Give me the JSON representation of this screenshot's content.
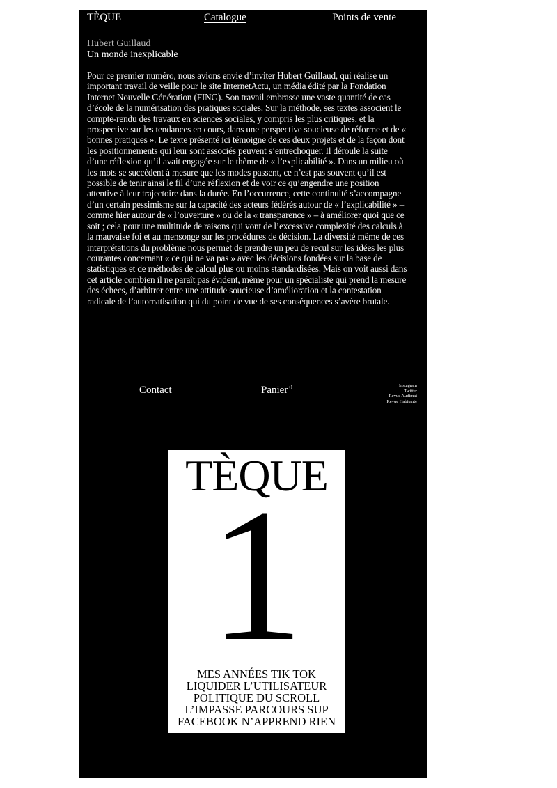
{
  "nav": {
    "brand": "TÈQUE",
    "catalogue": "Catalogue",
    "stores": "Points de vente"
  },
  "article": {
    "author": "Hubert Guillaud",
    "title": "Un monde inexplicable",
    "body": "Pour ce premier numéro, nous avions envie d’inviter Hubert Guillaud, qui réalise un important travail de veille pour le site InternetActu, un média édité par la Fondation Internet Nouvelle Génération (FING). Son travail embrasse une vaste quantité de cas d’école de la numérisation des pratiques sociales. Sur la méthode, ses textes associent le compte-rendu des travaux en sciences sociales, y compris les plus critiques, et la prospective sur les tendances en cours, dans une perspective soucieuse de réforme et de « bonnes pratiques ». Le texte présenté ici témoigne de ces deux projets et de la façon dont les positionnements qui leur sont associés peuvent s’entrechoquer. Il déroule la suite d’une réflexion qu’il avait engagée sur le thème de « l’explicabilité ». Dans un milieu où les mots se succèdent à mesure que les modes passent, ce n’est pas souvent qu’il est possible de tenir ainsi le fil d’une réflexion et de voir ce qu’engendre une position attentive à leur trajectoire dans la durée. En l’occurrence, cette continuité s’accompagne d’un certain pessimisme sur la capacité des acteurs fédérés autour de « l’explicabilité » – comme hier autour de « l’ouverture » ou de la « transparence » – à améliorer quoi que ce soit ; cela pour une multitude de raisons qui vont de l’excessive complexité des calculs à la mauvaise foi et au mensonge sur les procédures de décision. La diversité même de ces interprétations du problème nous permet de prendre un peu de recul sur les idées les plus courantes concernant « ce qui ne va pas » avec les décisions fondées sur la base de statistiques et de méthodes de calcul plus ou moins standardisées. Mais on voit aussi dans cet article combien il ne paraît pas évident, même pour un spécialiste qui prend la mesure des échecs, d’arbitrer entre une attitude soucieuse d’amélioration et la contestation radicale de l’automatisation qui du point de vue de ses conséquences s’avère brutale."
  },
  "footer": {
    "contact": "Contact",
    "cart": "Panier",
    "cart_count": "0",
    "social": [
      "Instagram",
      "Twitter",
      "Revue Audimat",
      "Revue Habitante"
    ]
  },
  "cover": {
    "title": "TÈQUE",
    "number": "1",
    "headlines": [
      "MES ANNÉES TIK TOK",
      "LIQUIDER L’UTILISATEUR",
      "POLITIQUE DU SCROLL",
      "L’IMPASSE PARCOURS SUP",
      "FACEBOOK N’APPREND RIEN"
    ]
  },
  "colors": {
    "background": "#000000",
    "text": "#ffffff",
    "cover_background": "#ffffff",
    "cover_text": "#000000"
  }
}
